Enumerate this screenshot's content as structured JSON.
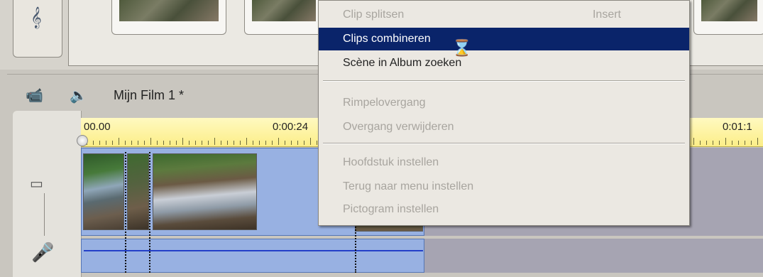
{
  "album": {
    "music_icon": "𝄞"
  },
  "movie": {
    "title": "Mijn Film 1 *",
    "camera_icon": "📹",
    "audio_icon": "🔈"
  },
  "tracks": {
    "video_icon": "▭",
    "mic_icon": "🎤"
  },
  "ruler": {
    "labels": [
      "00.00",
      "0:00:24",
      "0:01:1"
    ]
  },
  "context_menu": {
    "items": [
      {
        "label": "Clip splitsen",
        "shortcut": "Insert",
        "state": "disabled"
      },
      {
        "label": "Clips combineren",
        "shortcut": "",
        "state": "selected"
      },
      {
        "label": "Scène in Album zoeken",
        "shortcut": "",
        "state": "enabled"
      },
      {
        "label": "Rimpelovergang",
        "shortcut": "",
        "state": "disabled"
      },
      {
        "label": "Overgang verwijderen",
        "shortcut": "",
        "state": "disabled"
      },
      {
        "label": "Hoofdstuk instellen",
        "shortcut": "",
        "state": "disabled"
      },
      {
        "label": "Terug naar menu instellen",
        "shortcut": "",
        "state": "disabled"
      },
      {
        "label": "Pictogram instellen",
        "shortcut": "",
        "state": "disabled"
      }
    ]
  },
  "colors": {
    "selection": "#0a246a",
    "track": "#98b1e2",
    "ruler": "#fcee88"
  }
}
